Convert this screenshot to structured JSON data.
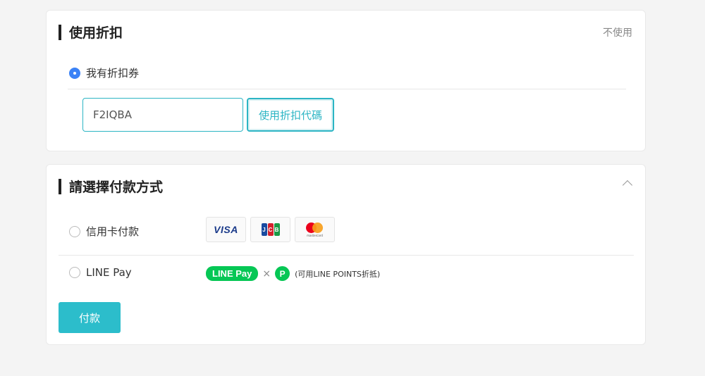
{
  "discount": {
    "title": "使用折扣",
    "not_use": "不使用",
    "option_label": "我有折扣券",
    "coupon_value": "F2IQBA",
    "apply_label": "使用折扣代碼"
  },
  "payment": {
    "title": "請選擇付款方式",
    "methods": [
      {
        "label": "信用卡付款",
        "logos": [
          "VISA",
          "JCB",
          "mastercard"
        ]
      },
      {
        "label": "LINE Pay",
        "badge": "LINE Pay",
        "times": "×",
        "points_icon": "P",
        "note": "(可用LINE POINTS折抵)"
      }
    ],
    "pay_button": "付款"
  },
  "colors": {
    "accent": "#2cb5c4",
    "radio_selected": "#3b82f6",
    "line_green": "#06c755"
  }
}
